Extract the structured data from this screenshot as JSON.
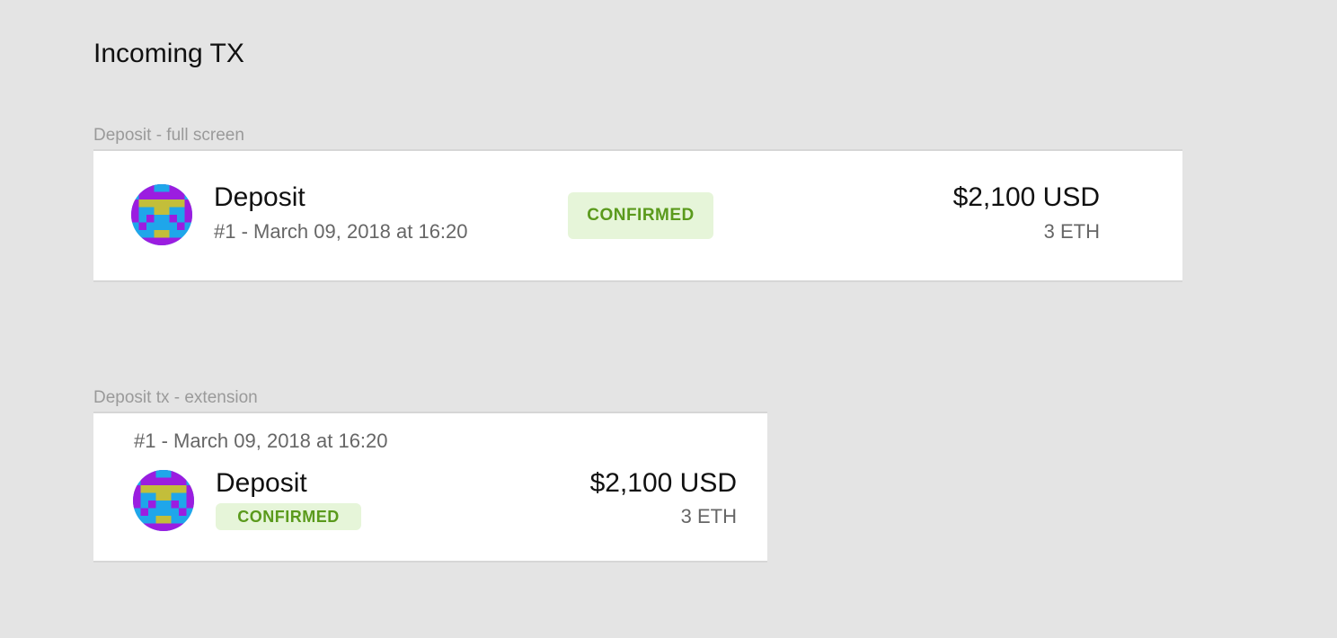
{
  "page": {
    "title": "Incoming TX"
  },
  "full_screen": {
    "section_label": "Deposit - full screen",
    "tx": {
      "title": "Deposit",
      "meta": "#1 - March 09, 2018 at 16:20",
      "status": "CONFIRMED",
      "amount_fiat": "$2,100 USD",
      "amount_crypto": "3 ETH",
      "avatar_icon": "identicon-avatar"
    }
  },
  "extension": {
    "section_label": "Deposit tx - extension",
    "tx": {
      "meta": "#1 - March 09, 2018 at 16:20",
      "title": "Deposit",
      "status": "CONFIRMED",
      "amount_fiat": "$2,100 USD",
      "amount_crypto": "3 ETH",
      "avatar_icon": "identicon-avatar"
    }
  },
  "colors": {
    "background": "#e4e4e4",
    "card": "#ffffff",
    "badge_bg": "#e6f5d9",
    "badge_text": "#5a9a1c",
    "identicon_purple": "#9b1de0",
    "identicon_blue": "#1fa6ea",
    "identicon_olive": "#c3be3a"
  }
}
